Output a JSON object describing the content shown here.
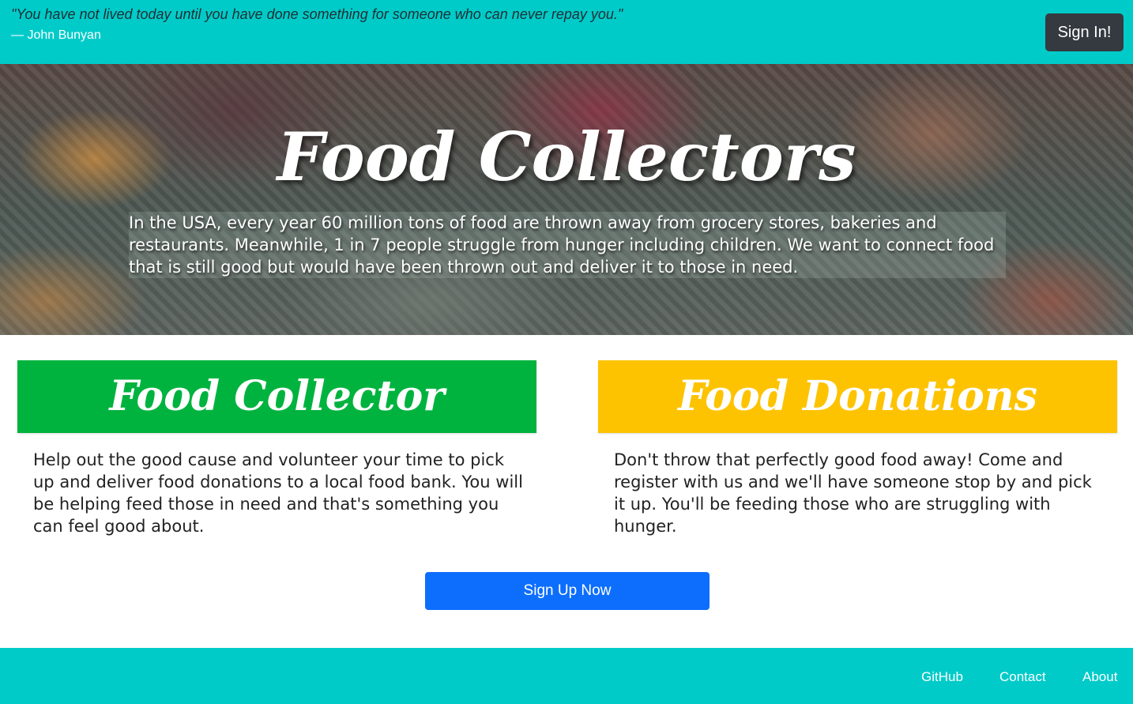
{
  "header": {
    "quote": "\"You have not lived today until you have done something for someone who can never repay you.\"",
    "author": "— John Bunyan",
    "signin_label": "Sign In!"
  },
  "hero": {
    "title": "Food Collectors",
    "text": "In the USA, every year 60 million tons of food are thrown away from grocery stores, bakeries and restaurants. Meanwhile, 1 in 7 people struggle from hunger including children. We want to connect food that is still good but would have been thrown out and deliver it to those in need."
  },
  "cards": {
    "collector": {
      "title": "Food Collector",
      "text": "Help out the good cause and volunteer your time to pick up and deliver food donations to a local food bank. You will be helping feed those in need and that's something you can feel good about.",
      "color": "#00b33e"
    },
    "donations": {
      "title": "Food Donations",
      "text": "Don't throw that perfectly good food away! Come and register with us and we'll have someone stop by and pick it up. You'll be feeding those who are struggling with hunger.",
      "color": "#fdc301"
    }
  },
  "cta": {
    "signup_label": "Sign Up Now"
  },
  "footer": {
    "links": [
      "GitHub",
      "Contact",
      "About"
    ]
  },
  "colors": {
    "accent": "#00cbc9",
    "primary_button": "#0d6efd",
    "dark_button": "#343a40"
  }
}
